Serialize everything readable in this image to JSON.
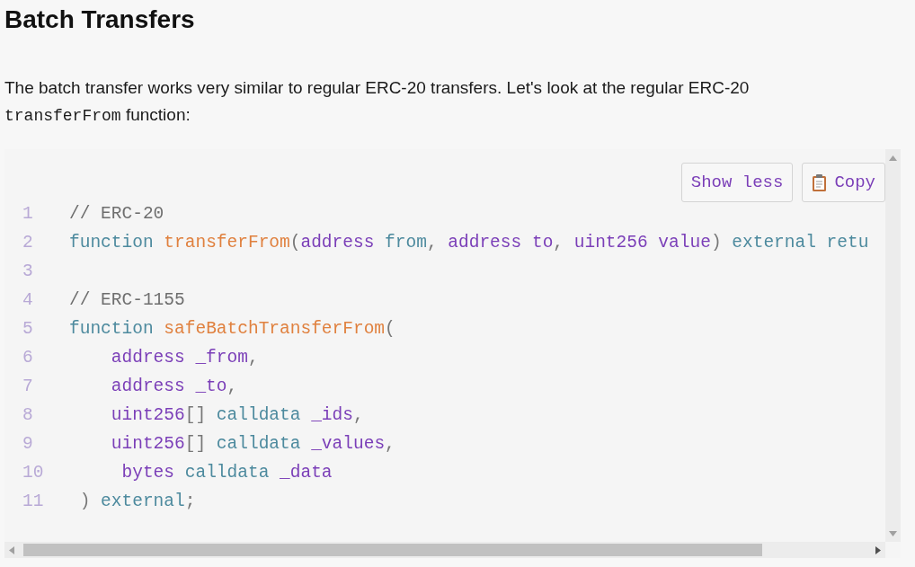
{
  "heading": "Batch Transfers",
  "paragraph": "The batch transfer works very similar to regular ERC-20 transfers. Let's look at the regular ERC-20",
  "paragraph_code": "transferFrom",
  "paragraph_end": "function:",
  "code_block": {
    "buttons": [
      {
        "label": "Show less",
        "kind": "text"
      },
      {
        "label": "Copy",
        "kind": "copy"
      }
    ],
    "lines": [
      {
        "number": "1",
        "tokens": [
          {
            "text": "// ERC-20",
            "kind": "comment"
          }
        ]
      },
      {
        "number": "2",
        "tokens": [
          {
            "text": "function ",
            "kind": "keyword"
          },
          {
            "text": "transferFrom",
            "kind": "function"
          },
          {
            "text": "(",
            "kind": "punct"
          },
          {
            "text": "address ",
            "kind": "type"
          },
          {
            "text": "from",
            "kind": "keyword"
          },
          {
            "text": ", ",
            "kind": "punct"
          },
          {
            "text": "address to",
            "kind": "type"
          },
          {
            "text": ", ",
            "kind": "punct"
          },
          {
            "text": "uint256 value",
            "kind": "type"
          },
          {
            "text": ") ",
            "kind": "punct"
          },
          {
            "text": "external retu",
            "kind": "keyword"
          }
        ]
      },
      {
        "number": "3"
      },
      {
        "number": "4",
        "tokens": [
          {
            "text": "// ERC-1155",
            "kind": "comment"
          }
        ]
      },
      {
        "number": "5",
        "tokens": [
          {
            "text": "function ",
            "kind": "keyword"
          },
          {
            "text": "safeBatchTransferFrom",
            "kind": "function"
          },
          {
            "text": "(",
            "kind": "punct"
          }
        ]
      },
      {
        "number": "6",
        "tokens": [
          {
            "text": "    address _from",
            "kind": "type"
          },
          {
            "text": ",",
            "kind": "punct"
          }
        ]
      },
      {
        "number": "7",
        "tokens": [
          {
            "text": "    address _to",
            "kind": "type"
          },
          {
            "text": ",",
            "kind": "punct"
          }
        ]
      },
      {
        "number": "8",
        "tokens": [
          {
            "text": "    uint256",
            "kind": "type"
          },
          {
            "text": "[] ",
            "kind": "punct"
          },
          {
            "text": "calldata ",
            "kind": "keyword"
          },
          {
            "text": "_ids",
            "kind": "type"
          },
          {
            "text": ",",
            "kind": "punct"
          }
        ]
      },
      {
        "number": "9",
        "tokens": [
          {
            "text": "    uint256",
            "kind": "type"
          },
          {
            "text": "[] ",
            "kind": "punct"
          },
          {
            "text": "calldata ",
            "kind": "keyword"
          },
          {
            "text": "_values",
            "kind": "type"
          },
          {
            "text": ",",
            "kind": "punct"
          }
        ]
      },
      {
        "number": "10",
        "tokens": [
          {
            "text": "     bytes ",
            "kind": "type"
          },
          {
            "text": "calldata ",
            "kind": "keyword"
          },
          {
            "text": "_data",
            "kind": "type"
          }
        ]
      },
      {
        "number": "11",
        "tokens": [
          {
            "text": " ) ",
            "kind": "punct"
          },
          {
            "text": "external",
            "kind": "keyword"
          },
          {
            "text": ";",
            "kind": "punct"
          }
        ]
      }
    ]
  }
}
